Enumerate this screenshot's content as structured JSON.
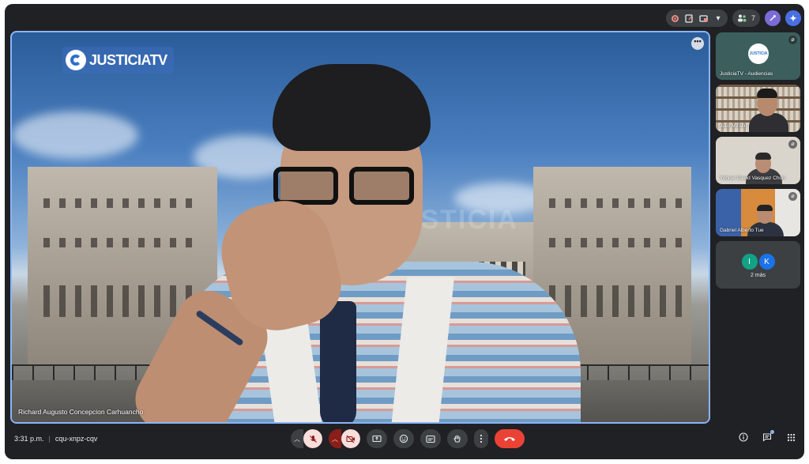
{
  "topbar": {
    "participant_count": "7",
    "icons": [
      "record-icon",
      "notes-icon",
      "files-icon",
      "chevron-down-icon",
      "people-icon",
      "activities-icon",
      "gemini-icon"
    ]
  },
  "stage": {
    "logo_text": "JUSTICIATV",
    "watermark": "JUSTICIA",
    "speaker_name": "Richard Augusto Concepcion Carhuancho"
  },
  "tiles": [
    {
      "name": "JusticiaTV - Audiencias"
    },
    {
      "name": "Julio Mirallo"
    },
    {
      "name": "Yohner David Vasquez Chon"
    },
    {
      "name": "Gabriel Alberto Tue"
    },
    {
      "avatars": [
        "I",
        "K"
      ],
      "more_label": "2 más"
    }
  ],
  "footer": {
    "time": "3:31 p.m.",
    "meeting_code": "cqu-xnpz-cqv"
  },
  "colors": {
    "background": "#202124",
    "accent": "#8ab4f8",
    "end_call": "#ea4335",
    "muted": "#f9dedc"
  }
}
